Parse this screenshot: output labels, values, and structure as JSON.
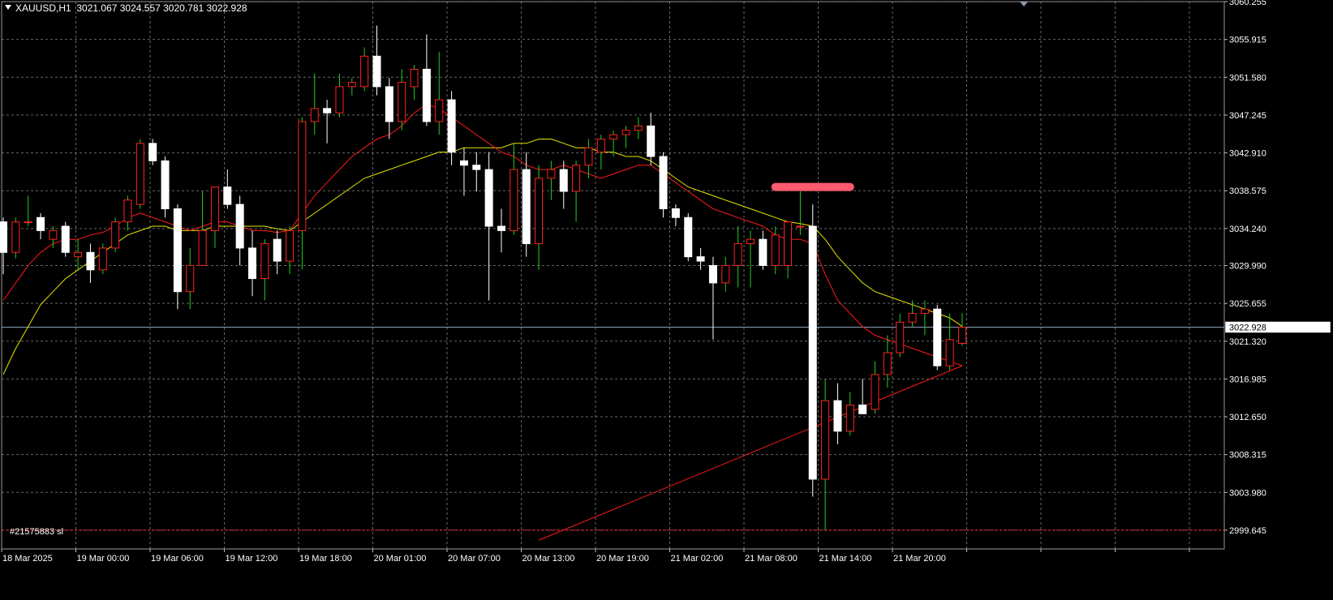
{
  "header": {
    "symbol": "XAUUSD,H1",
    "ohlc": "3021.067 3024.557 3020.781 3022.928"
  },
  "order_label": "#21575883 sl",
  "current_price_label": "3022.928",
  "colors": {
    "background": "#000000",
    "grid": "#8a8a8a",
    "bull_body": "#000000",
    "bull_wick": "#22cc22",
    "bear_body": "#ffffff",
    "bear_wick": "#ffffff",
    "candle_outline_bull": "#ff2020",
    "ma_fast": "#ff1a1a",
    "ma_slow": "#e6e600",
    "sl_line": "#ff2020",
    "marker": "#ff5a6e",
    "price_line": "#8aa0b8"
  },
  "chart_data": {
    "type": "candlestick",
    "symbol": "XAUUSD",
    "timeframe": "H1",
    "ylim": [
      2997.5,
      3060.255
    ],
    "y_ticks": [
      "3060.255",
      "3055.915",
      "3051.580",
      "3047.245",
      "3042.910",
      "3038.575",
      "3034.240",
      "3029.990",
      "3025.655",
      "3021.320",
      "3016.985",
      "3012.650",
      "3008.315",
      "3003.980",
      "2999.645"
    ],
    "x_ticks": [
      "18 Mar 2025",
      "19 Mar 00:00",
      "19 Mar 06:00",
      "19 Mar 12:00",
      "19 Mar 18:00",
      "20 Mar 01:00",
      "20 Mar 07:00",
      "20 Mar 13:00",
      "20 Mar 19:00",
      "21 Mar 02:00",
      "21 Mar 08:00",
      "21 Mar 14:00",
      "21 Mar 20:00"
    ],
    "candles": [
      [
        3035.0,
        3035.5,
        3029.0,
        3031.5
      ],
      [
        3031.5,
        3035.5,
        3030.8,
        3035.0
      ],
      [
        3035.0,
        3038.0,
        3034.5,
        3035.0
      ],
      [
        3035.5,
        3036.0,
        3033.0,
        3034.0
      ],
      [
        3033.0,
        3034.5,
        3032.0,
        3034.0
      ],
      [
        3034.5,
        3035.0,
        3031.0,
        3031.5
      ],
      [
        3031.0,
        3033.0,
        3029.5,
        3031.5
      ],
      [
        3031.5,
        3032.5,
        3028.0,
        3029.5
      ],
      [
        3029.5,
        3032.5,
        3029.0,
        3032.0
      ],
      [
        3032.0,
        3035.5,
        3031.5,
        3035.0
      ],
      [
        3035.0,
        3038.0,
        3034.0,
        3037.5
      ],
      [
        3037.0,
        3044.5,
        3036.5,
        3044.0
      ],
      [
        3044.0,
        3044.5,
        3041.5,
        3042.0
      ],
      [
        3042.0,
        3042.5,
        3035.5,
        3036.5
      ],
      [
        3036.5,
        3037.0,
        3025.0,
        3027.0
      ],
      [
        3027.0,
        3032.0,
        3025.0,
        3030.0
      ],
      [
        3030.0,
        3038.5,
        3030.0,
        3034.0
      ],
      [
        3034.0,
        3039.0,
        3032.0,
        3039.0
      ],
      [
        3039.0,
        3041.0,
        3036.5,
        3037.0
      ],
      [
        3037.0,
        3038.0,
        3030.0,
        3032.0
      ],
      [
        3032.0,
        3034.0,
        3026.5,
        3028.5
      ],
      [
        3028.5,
        3033.0,
        3026.0,
        3032.5
      ],
      [
        3033.0,
        3034.0,
        3029.0,
        3030.5
      ],
      [
        3030.5,
        3034.5,
        3029.0,
        3034.0
      ],
      [
        3034.0,
        3047.0,
        3029.5,
        3046.5
      ],
      [
        3046.5,
        3052.0,
        3045.0,
        3048.0
      ],
      [
        3048.0,
        3049.0,
        3044.0,
        3047.5
      ],
      [
        3047.5,
        3052.0,
        3047.0,
        3050.5
      ],
      [
        3050.5,
        3051.5,
        3049.5,
        3051.0
      ],
      [
        3050.5,
        3055.0,
        3050.0,
        3054.0
      ],
      [
        3054.0,
        3057.5,
        3049.5,
        3050.5
      ],
      [
        3050.5,
        3051.5,
        3044.5,
        3046.5
      ],
      [
        3046.5,
        3052.5,
        3045.5,
        3051.0
      ],
      [
        3050.5,
        3053.0,
        3049.0,
        3052.5
      ],
      [
        3052.5,
        3056.5,
        3046.0,
        3046.5
      ],
      [
        3046.5,
        3054.5,
        3045.0,
        3049.0
      ],
      [
        3049.0,
        3050.0,
        3041.5,
        3043.0
      ],
      [
        3042.0,
        3043.5,
        3038.0,
        3041.5
      ],
      [
        3041.5,
        3043.0,
        3038.5,
        3041.0
      ],
      [
        3041.0,
        3043.0,
        3026.0,
        3034.5
      ],
      [
        3034.5,
        3036.5,
        3031.5,
        3034.0
      ],
      [
        3034.0,
        3044.0,
        3033.5,
        3041.0
      ],
      [
        3041.0,
        3043.0,
        3031.0,
        3032.5
      ],
      [
        3032.5,
        3041.5,
        3029.5,
        3040.0
      ],
      [
        3040.0,
        3042.0,
        3037.5,
        3041.0
      ],
      [
        3041.0,
        3042.0,
        3036.5,
        3038.5
      ],
      [
        3038.5,
        3042.0,
        3035.0,
        3041.5
      ],
      [
        3041.5,
        3044.5,
        3040.0,
        3043.5
      ],
      [
        3043.0,
        3045.0,
        3041.0,
        3044.5
      ],
      [
        3044.5,
        3045.5,
        3042.5,
        3045.0
      ],
      [
        3045.0,
        3046.0,
        3043.5,
        3045.5
      ],
      [
        3045.5,
        3047.0,
        3044.5,
        3046.0
      ],
      [
        3046.0,
        3047.5,
        3041.5,
        3042.5
      ],
      [
        3042.5,
        3043.0,
        3035.5,
        3036.5
      ],
      [
        3036.5,
        3037.0,
        3034.5,
        3035.5
      ],
      [
        3035.5,
        3036.0,
        3030.5,
        3031.0
      ],
      [
        3031.0,
        3032.0,
        3029.5,
        3030.5
      ],
      [
        3030.0,
        3031.0,
        3021.5,
        3028.0
      ],
      [
        3028.0,
        3031.0,
        3027.0,
        3030.0
      ],
      [
        3030.0,
        3034.5,
        3027.5,
        3032.5
      ],
      [
        3032.5,
        3034.0,
        3027.5,
        3033.0
      ],
      [
        3033.0,
        3034.0,
        3029.5,
        3030.0
      ],
      [
        3030.0,
        3034.5,
        3029.0,
        3033.5
      ],
      [
        3030.0,
        3034.0,
        3028.5,
        3035.0
      ],
      [
        3034.5,
        3038.5,
        3033.5,
        3034.5
      ],
      [
        3034.5,
        3037.0,
        3003.5,
        3005.5
      ],
      [
        3005.5,
        3017.0,
        2999.6,
        3014.5
      ],
      [
        3014.5,
        3016.5,
        3009.5,
        3011.0
      ],
      [
        3011.0,
        3015.5,
        3010.5,
        3014.0
      ],
      [
        3014.0,
        3017.0,
        3013.5,
        3013.0
      ],
      [
        3013.5,
        3019.0,
        3013.0,
        3017.5
      ],
      [
        3017.5,
        3022.0,
        3016.0,
        3020.0
      ],
      [
        3020.0,
        3024.5,
        3019.5,
        3023.5
      ],
      [
        3023.5,
        3026.0,
        3023.0,
        3024.5
      ],
      [
        3024.5,
        3026.0,
        3022.0,
        3025.0
      ],
      [
        3025.0,
        3025.5,
        3018.0,
        3018.5
      ],
      [
        3018.5,
        3024.5,
        3018.0,
        3021.5
      ],
      [
        3021.067,
        3024.557,
        3020.781,
        3022.928
      ]
    ],
    "ma_slow": [
      3017.5,
      3020.5,
      3023.0,
      3025.5,
      3027.0,
      3028.5,
      3029.5,
      3030.5,
      3031.5,
      3032.5,
      3033.5,
      3034.0,
      3034.5,
      3034.5,
      3034.0,
      3034.0,
      3034.0,
      3034.5,
      3034.5,
      3034.5,
      3034.5,
      3034.5,
      3034.2,
      3034.0,
      3035.0,
      3036.0,
      3037.0,
      3038.0,
      3039.0,
      3040.0,
      3040.5,
      3041.0,
      3041.5,
      3042.0,
      3042.5,
      3043.0,
      3043.0,
      3043.5,
      3043.5,
      3043.5,
      3043.5,
      3044.0,
      3044.0,
      3044.5,
      3044.5,
      3044.0,
      3043.5,
      3043.5,
      3043.0,
      3043.0,
      3042.5,
      3042.5,
      3042.0,
      3041.0,
      3040.0,
      3039.0,
      3038.5,
      3038.0,
      3037.5,
      3037.0,
      3036.5,
      3036.0,
      3035.5,
      3035.0,
      3034.8,
      3034.5,
      3033.0,
      3031.0,
      3029.5,
      3028.0,
      3027.0,
      3026.5,
      3026.0,
      3025.5,
      3025.0,
      3024.5,
      3024.0,
      3023.0
    ],
    "ma_fast": [
      3026.0,
      3028.0,
      3030.0,
      3031.5,
      3032.5,
      3033.0,
      3033.0,
      3033.5,
      3033.8,
      3034.5,
      3035.5,
      3036.0,
      3035.5,
      3035.0,
      3034.5,
      3034.0,
      3034.5,
      3035.0,
      3035.0,
      3034.5,
      3034.0,
      3034.0,
      3033.8,
      3034.0,
      3036.0,
      3038.0,
      3039.5,
      3041.0,
      3042.5,
      3043.5,
      3044.5,
      3045.0,
      3046.0,
      3047.5,
      3048.5,
      3048.0,
      3047.0,
      3046.0,
      3045.0,
      3044.0,
      3043.0,
      3042.5,
      3041.5,
      3041.0,
      3041.0,
      3041.5,
      3041.0,
      3040.5,
      3040.0,
      3040.5,
      3041.0,
      3041.5,
      3041.5,
      3040.5,
      3039.5,
      3038.5,
      3037.5,
      3036.5,
      3036.0,
      3035.5,
      3035.0,
      3034.5,
      3033.5,
      3033.0,
      3033.0,
      3032.5,
      3029.0,
      3026.0,
      3024.5,
      3023.0,
      3022.0,
      3021.5,
      3021.0,
      3020.5,
      3020.0,
      3019.5,
      3019.0,
      3018.5
    ],
    "ma_long_segment": {
      "from_index": 43,
      "from_value": 2998.5,
      "to_index": 77,
      "to_value": 3018.5
    },
    "stop_loss": 2999.645,
    "current_price": 3022.928,
    "marker": {
      "from_index": 62,
      "to_index": 68,
      "value": 3039.0
    }
  }
}
